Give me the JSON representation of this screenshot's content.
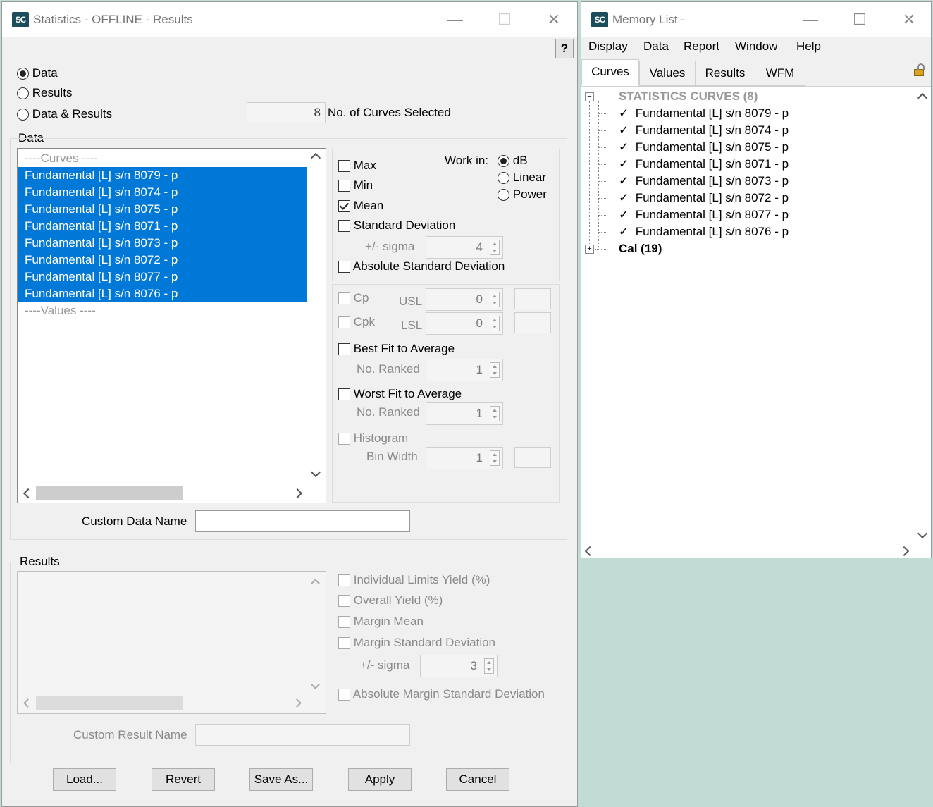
{
  "stats_window": {
    "title": "Statistics  - OFFLINE - Results",
    "help_label": "?",
    "mode_options": [
      {
        "label": "Data",
        "selected": true
      },
      {
        "label": "Results",
        "selected": false
      },
      {
        "label": "Data & Results",
        "selected": false
      }
    ],
    "curves_selected_count": "8",
    "curves_selected_label": "No. of Curves Selected",
    "data_group_label": "Data",
    "data_list": {
      "curves_header": "----Curves ----",
      "items": [
        "Fundamental [L] s/n 8079 - p",
        "Fundamental [L] s/n 8074 - p",
        "Fundamental [L] s/n 8075 - p",
        "Fundamental [L] s/n 8071 - p",
        "Fundamental [L] s/n 8073 - p",
        "Fundamental [L] s/n 8072 - p",
        "Fundamental [L] s/n 8077 - p",
        "Fundamental [L] s/n 8076 - p"
      ],
      "values_header": "----Values ----"
    },
    "options": {
      "max_label": "Max",
      "min_label": "Min",
      "mean_label": "Mean",
      "stddev_label": "Standard Deviation",
      "sigma_label": "+/- sigma",
      "sigma_value": "4",
      "abs_stddev_label": "Absolute Standard Deviation",
      "work_in_label": "Work in:",
      "work_in_options": [
        {
          "label": "dB",
          "selected": true
        },
        {
          "label": "Linear",
          "selected": false
        },
        {
          "label": "Power",
          "selected": false
        }
      ],
      "cp_label": "Cp",
      "usl_label": "USL",
      "usl_value": "0",
      "cpk_label": "Cpk",
      "lsl_label": "LSL",
      "lsl_value": "0",
      "best_fit_label": "Best Fit to Average",
      "best_ranked_label": "No. Ranked",
      "best_ranked_value": "1",
      "worst_fit_label": "Worst Fit to Average",
      "worst_ranked_label": "No. Ranked",
      "worst_ranked_value": "1",
      "histogram_label": "Histogram",
      "bin_width_label": "Bin Width",
      "bin_width_value": "1"
    },
    "custom_data_name_label": "Custom Data Name",
    "custom_data_name_value": "",
    "results_group_label": "Results",
    "results_options": {
      "individual_yield_label": "Individual Limits Yield (%)",
      "overall_yield_label": "Overall Yield (%)",
      "margin_mean_label": "Margin Mean",
      "margin_stddev_label": "Margin Standard Deviation",
      "margin_sigma_label": "+/- sigma",
      "margin_sigma_value": "3",
      "abs_margin_stddev_label": "Absolute Margin Standard Deviation"
    },
    "custom_result_name_label": "Custom Result Name",
    "custom_result_name_value": "",
    "buttons": {
      "load": "Load...",
      "revert": "Revert",
      "save_as": "Save As...",
      "apply": "Apply",
      "cancel": "Cancel"
    }
  },
  "memory_window": {
    "title": "Memory List -",
    "menu": [
      "Display",
      "Data",
      "Report",
      "Window",
      "Help"
    ],
    "tabs": [
      "Curves",
      "Values",
      "Results",
      "WFM"
    ],
    "tree": {
      "root_label": "STATISTICS CURVES (8)",
      "items": [
        "Fundamental [L] s/n 8079 - p",
        "Fundamental [L] s/n 8074 - p",
        "Fundamental [L] s/n 8075 - p",
        "Fundamental [L] s/n 8071 - p",
        "Fundamental [L] s/n 8073 - p",
        "Fundamental [L] s/n 8072 - p",
        "Fundamental [L] s/n 8077 - p",
        "Fundamental [L] s/n 8076 - p"
      ],
      "check_mark": "✓",
      "cal_label": "Cal (19)"
    }
  },
  "logo_text": "SC"
}
